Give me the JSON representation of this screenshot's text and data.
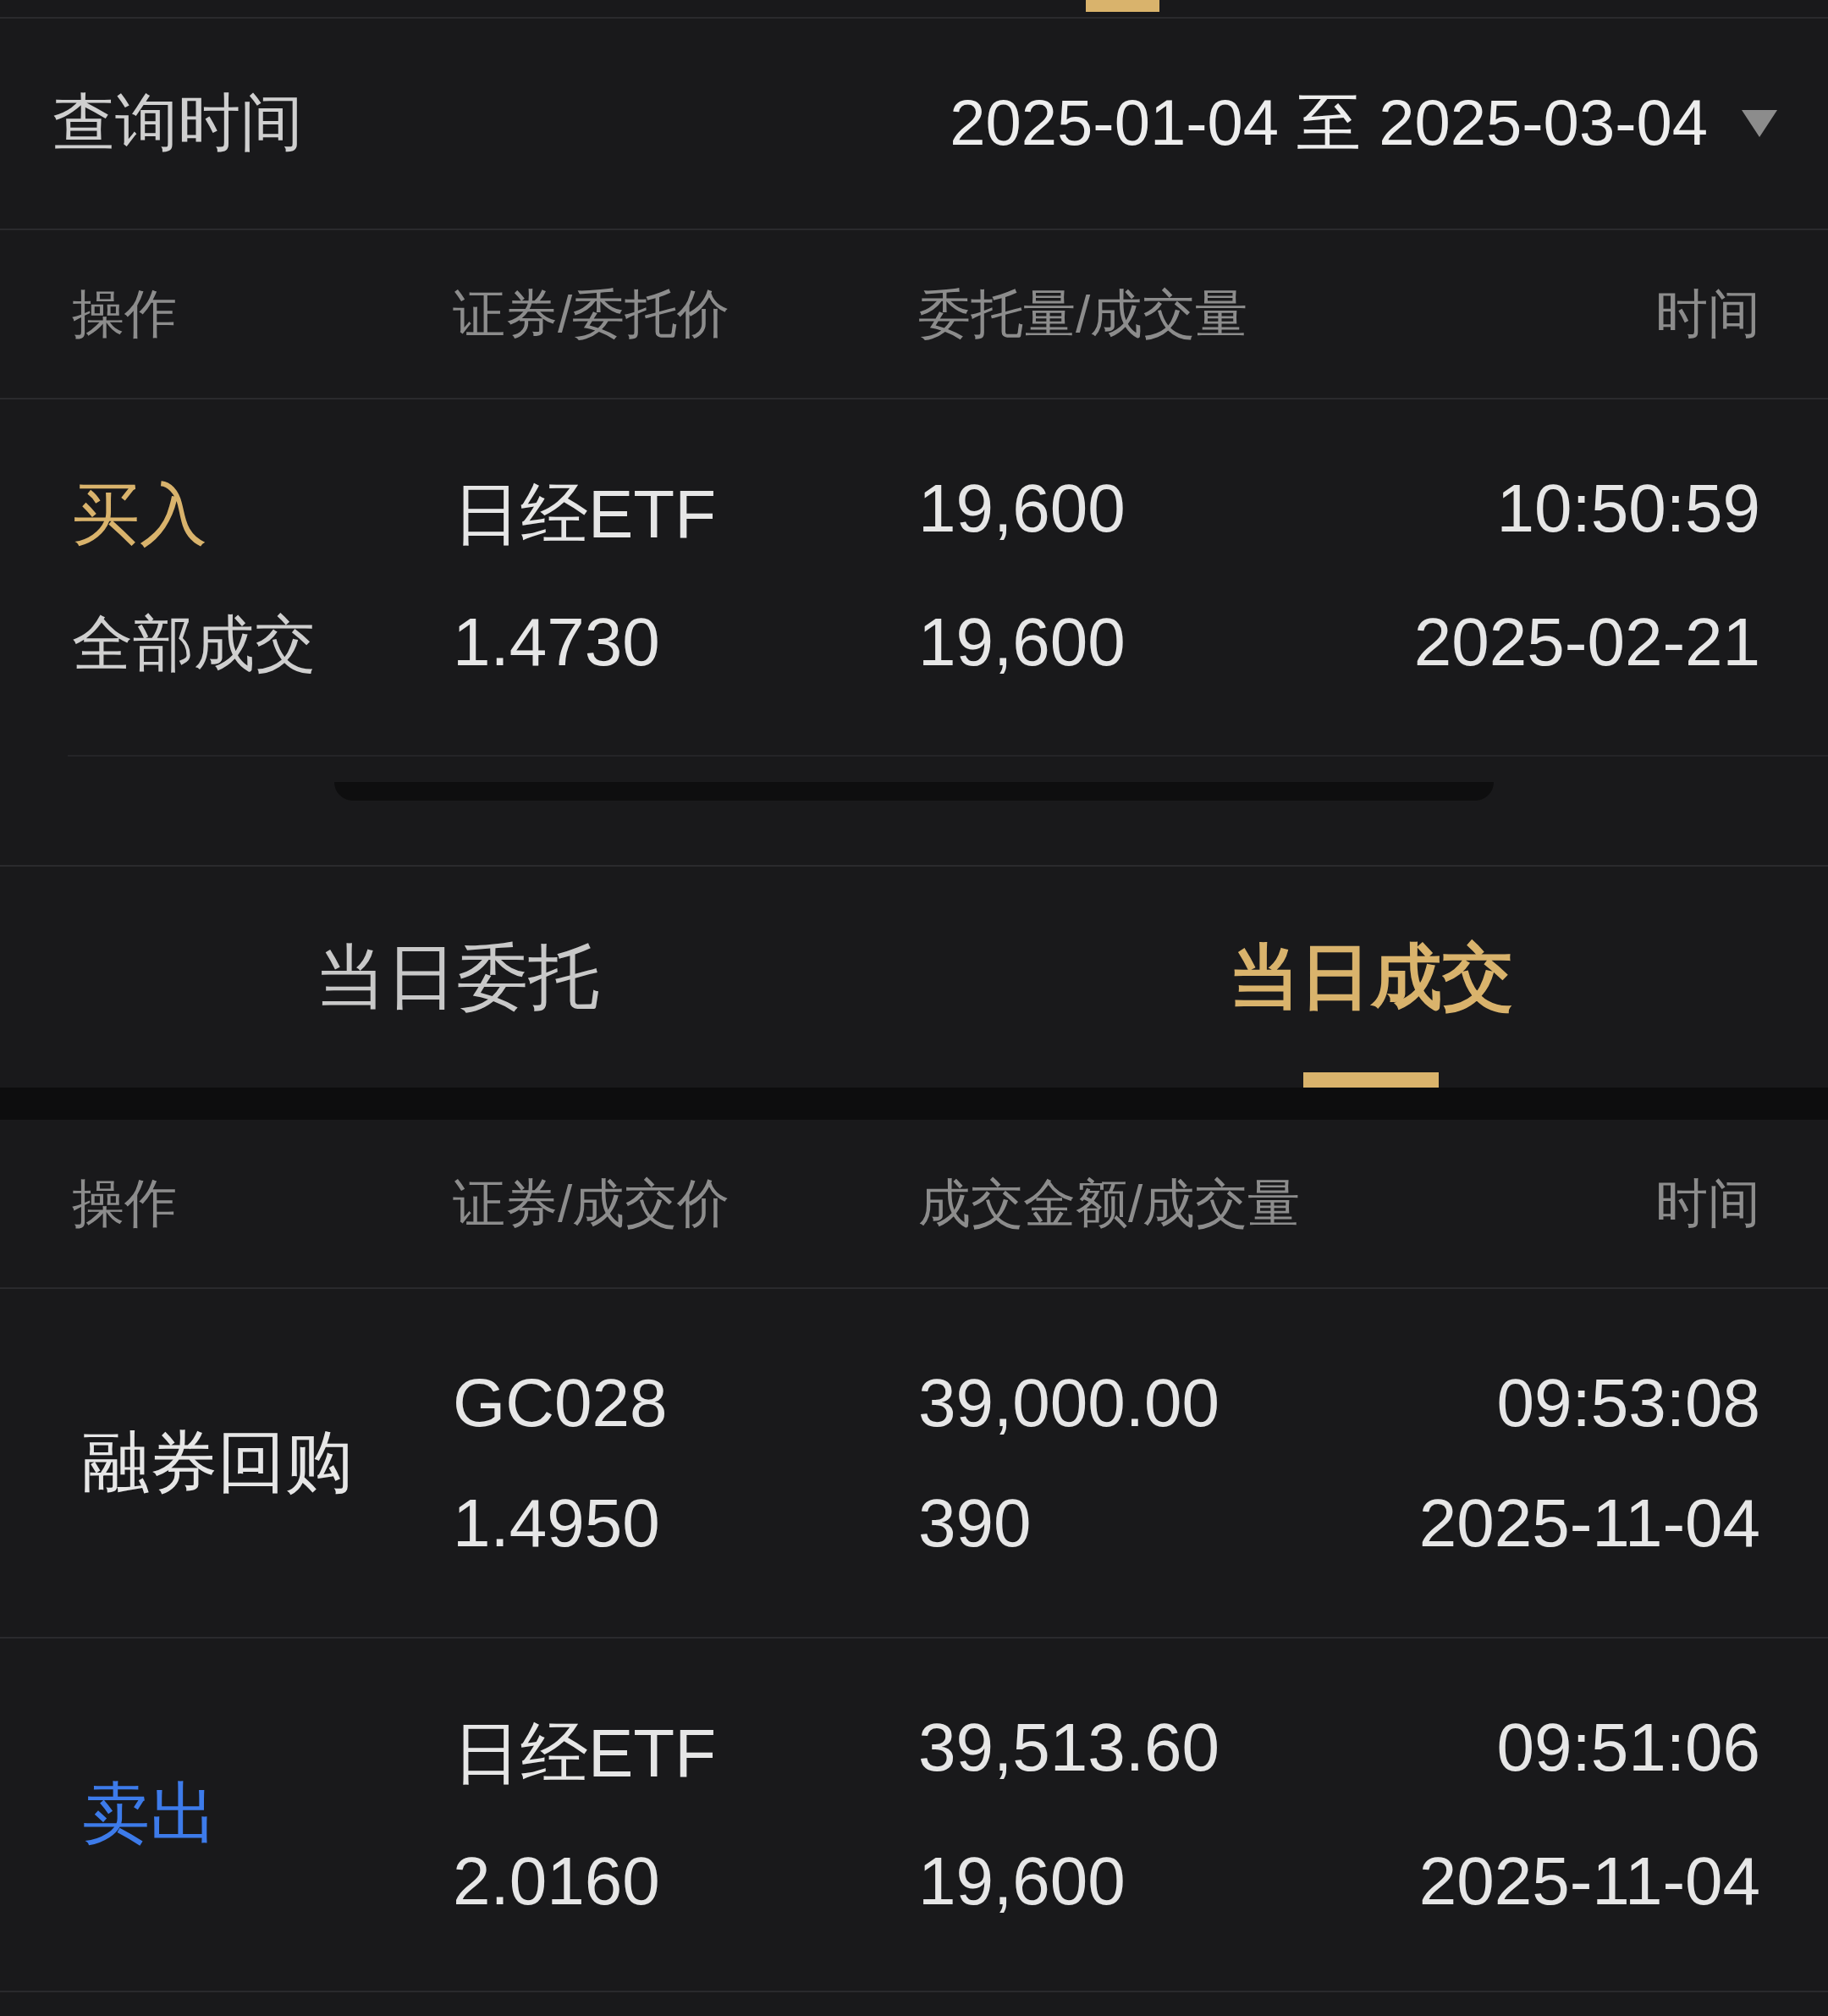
{
  "query": {
    "label": "查询时间",
    "range": "2025-01-04 至 2025-03-04"
  },
  "history_table": {
    "columns": [
      "操作",
      "证券/委托价",
      "委托量/成交量",
      "时间"
    ],
    "rows": [
      {
        "kind": "buy",
        "action": "买入",
        "status": "全部成交",
        "security": "日经ETF",
        "price": "1.4730",
        "order_qty": "19,600",
        "filled_qty": "19,600",
        "time": "10:50:59",
        "date": "2025-02-21"
      }
    ]
  },
  "tabs": [
    {
      "label": "当日委托",
      "selected": false
    },
    {
      "label": "当日成交",
      "selected": true
    }
  ],
  "trades_table": {
    "columns": [
      "操作",
      "证券/成交价",
      "成交金额/成交量",
      "时间"
    ],
    "rows": [
      {
        "kind": "repo",
        "action": "融券回购",
        "security": "GC028",
        "price": "1.4950",
        "amount": "39,000.00",
        "volume": "390",
        "time": "09:53:08",
        "date": "2025-11-04"
      },
      {
        "kind": "sell",
        "action": "卖出",
        "security": "日经ETF",
        "price": "2.0160",
        "amount": "39,513.60",
        "volume": "19,600",
        "time": "09:51:06",
        "date": "2025-11-04"
      }
    ]
  }
}
